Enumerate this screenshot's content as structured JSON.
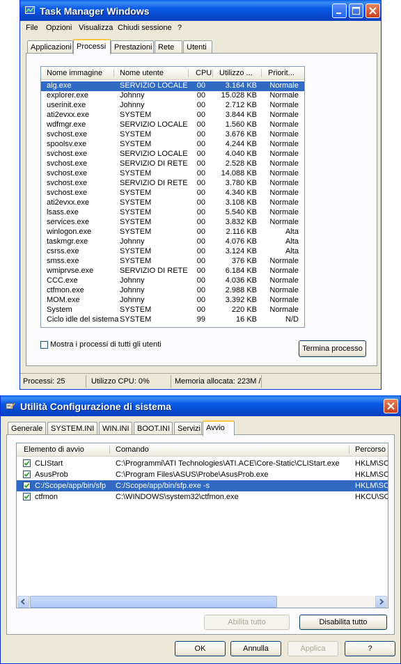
{
  "taskmanager": {
    "title": "Task Manager Windows",
    "menu": [
      "File",
      "Opzioni",
      "Visualizza",
      "Chiudi sessione",
      "?"
    ],
    "tabs": [
      "Applicazioni",
      "Processi",
      "Prestazioni",
      "Rete",
      "Utenti"
    ],
    "active_tab": "Processi",
    "columns": [
      "Nome immagine",
      "Nome utente",
      "CPU",
      "Utilizzo ...",
      "Priorit..."
    ],
    "processes": [
      [
        "alg.exe",
        "SERVIZIO LOCALE",
        "00",
        "3.164 KB",
        "Normale"
      ],
      [
        "explorer.exe",
        "Johnny",
        "00",
        "15.028 KB",
        "Normale"
      ],
      [
        "userinit.exe",
        "Johnny",
        "00",
        "2.712 KB",
        "Normale"
      ],
      [
        "ati2evxx.exe",
        "SYSTEM",
        "00",
        "3.844 KB",
        "Normale"
      ],
      [
        "wdfmgr.exe",
        "SERVIZIO LOCALE",
        "00",
        "1.560 KB",
        "Normale"
      ],
      [
        "svchost.exe",
        "SYSTEM",
        "00",
        "3.676 KB",
        "Normale"
      ],
      [
        "spoolsv.exe",
        "SYSTEM",
        "00",
        "4.244 KB",
        "Normale"
      ],
      [
        "svchost.exe",
        "SERVIZIO LOCALE",
        "00",
        "4.040 KB",
        "Normale"
      ],
      [
        "svchost.exe",
        "SERVIZIO DI RETE",
        "00",
        "2.528 KB",
        "Normale"
      ],
      [
        "svchost.exe",
        "SYSTEM",
        "00",
        "14.088 KB",
        "Normale"
      ],
      [
        "svchost.exe",
        "SERVIZIO DI RETE",
        "00",
        "3.780 KB",
        "Normale"
      ],
      [
        "svchost.exe",
        "SYSTEM",
        "00",
        "4.340 KB",
        "Normale"
      ],
      [
        "ati2evxx.exe",
        "SYSTEM",
        "00",
        "3.108 KB",
        "Normale"
      ],
      [
        "lsass.exe",
        "SYSTEM",
        "00",
        "5.540 KB",
        "Normale"
      ],
      [
        "services.exe",
        "SYSTEM",
        "00",
        "3.832 KB",
        "Normale"
      ],
      [
        "winlogon.exe",
        "SYSTEM",
        "00",
        "2.116 KB",
        "Alta"
      ],
      [
        "taskmgr.exe",
        "Johnny",
        "00",
        "4.076 KB",
        "Alta"
      ],
      [
        "csrss.exe",
        "SYSTEM",
        "00",
        "3.124 KB",
        "Alta"
      ],
      [
        "smss.exe",
        "SYSTEM",
        "00",
        "376 KB",
        "Normale"
      ],
      [
        "wmiprvse.exe",
        "SERVIZIO DI RETE",
        "00",
        "6.184 KB",
        "Normale"
      ],
      [
        "CCC.exe",
        "Johnny",
        "00",
        "4.036 KB",
        "Normale"
      ],
      [
        "ctfmon.exe",
        "Johnny",
        "00",
        "2.988 KB",
        "Normale"
      ],
      [
        "MOM.exe",
        "Johnny",
        "00",
        "3.392 KB",
        "Normale"
      ],
      [
        "System",
        "SYSTEM",
        "00",
        "220 KB",
        "Normale"
      ],
      [
        "Ciclo idle del sistema",
        "SYSTEM",
        "99",
        "16 KB",
        "N/D"
      ]
    ],
    "show_all_label": "Mostra i processi di tutti gli utenti",
    "end_process_label": "Termina processo",
    "status": {
      "processes": "Processi: 25",
      "cpu": "Utilizzo CPU: 0%",
      "memory": "Memoria allocata: 223M /"
    }
  },
  "msconfig": {
    "title": "Utilità Configurazione di sistema",
    "tabs": [
      "Generale",
      "SYSTEM.INI",
      "WIN.INI",
      "BOOT.INI",
      "Servizi",
      "Avvio"
    ],
    "active_tab": "Avvio",
    "columns": [
      "Elemento di avvio",
      "Comando",
      "Percorso"
    ],
    "items": [
      {
        "name": "CLIStart",
        "command": "C:\\Programmi\\ATI Technologies\\ATI.ACE\\Core-Static\\CLIStart.exe",
        "path": "HKLM\\SOF"
      },
      {
        "name": "AsusProb",
        "command": "C:\\Program Files\\ASUS\\Probe\\AsusProb.exe",
        "path": "HKLM\\SOF"
      },
      {
        "name": "C:/Scope/app/bin/sfp",
        "command": "C:/Scope/app/bin/sfp.exe -s",
        "path": "HKLM\\SOF"
      },
      {
        "name": "ctfmon",
        "command": "C:\\WINDOWS\\system32\\ctfmon.exe",
        "path": "HKCU\\SOF"
      }
    ],
    "enable_all_label": "Abilita tutto",
    "disable_all_label": "Disabilita tutto",
    "ok_label": "OK",
    "cancel_label": "Annulla",
    "apply_label": "Applica",
    "help_label": "?"
  },
  "colors": {
    "titlebar": "#0a5ae6",
    "selection": "#316ac5",
    "window_bg": "#ece9d8"
  }
}
